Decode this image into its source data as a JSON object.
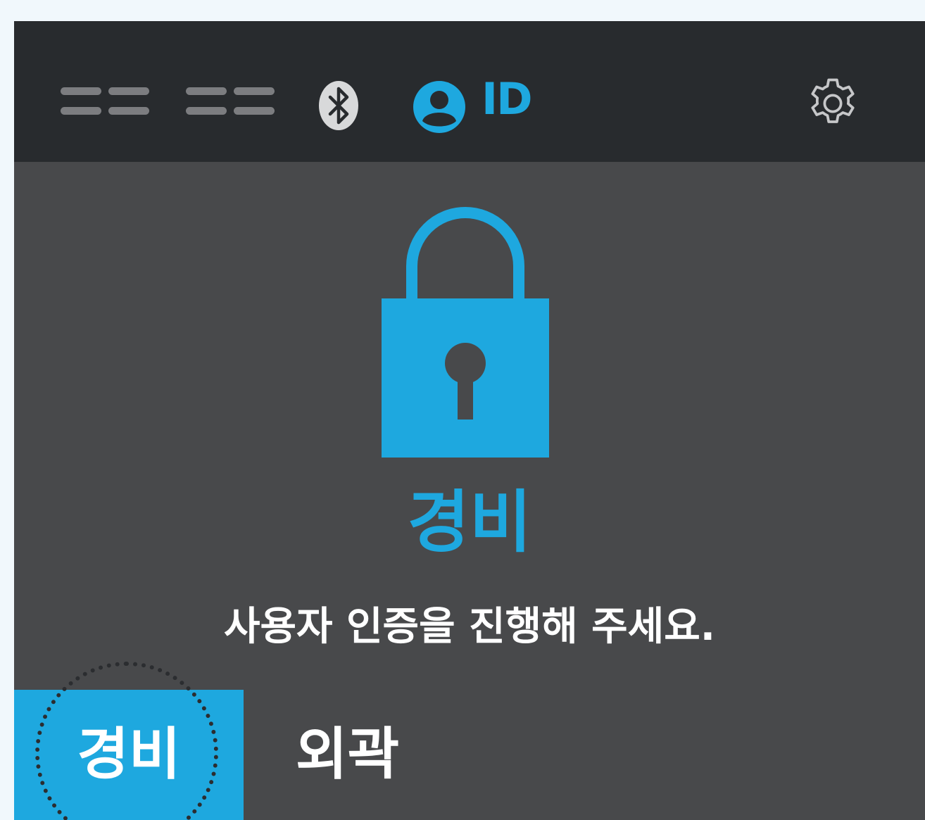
{
  "status_bar": {
    "signal_icons": [
      "signal-bars-icon",
      "signal-bars-icon"
    ],
    "bluetooth_icon": "bluetooth-icon",
    "user_icon": "user-icon",
    "id_label": "ID",
    "settings_icon": "gear-icon"
  },
  "main": {
    "lock_icon": "lock-icon",
    "mode_title": "경비",
    "prompt": "사용자 인증을 진행해 주세요."
  },
  "tabs": [
    {
      "label": "경비",
      "selected": true
    },
    {
      "label": "외곽",
      "selected": false
    }
  ],
  "colors": {
    "accent": "#1ea8df",
    "topbar": "#282b2e",
    "panel": "#48494b",
    "page_background": "#f1f8fc",
    "text": "#ffffff",
    "icon_gray": "#7c7d80"
  }
}
